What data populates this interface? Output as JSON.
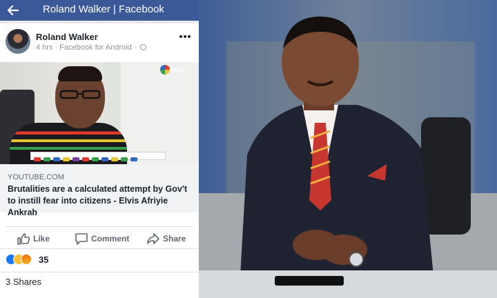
{
  "appbar": {
    "title": "Roland Walker | Facebook",
    "back_icon": "arrow-left-icon"
  },
  "post": {
    "author": "Roland Walker",
    "meta": "4 hrs · Facebook for Android ·",
    "more_icon": "more-dots-icon",
    "link": {
      "image_logo_text": "NEWS",
      "domain": "YOUTUBE.COM",
      "headline": "Brutalities are a calculated attempt by Gov't to instill fear into citizens - Elvis Afriyie Ankrah"
    },
    "actions": {
      "like": "Like",
      "comment": "Comment",
      "share": "Share"
    },
    "reactions": {
      "icons": [
        "like-reaction-icon",
        "haha-reaction-icon",
        "angry-reaction-icon"
      ],
      "count": "35"
    },
    "shares": "3 Shares"
  },
  "colors": {
    "facebook_blue": "#3b5998",
    "text_dark": "#1d2129",
    "text_muted": "#606770"
  }
}
